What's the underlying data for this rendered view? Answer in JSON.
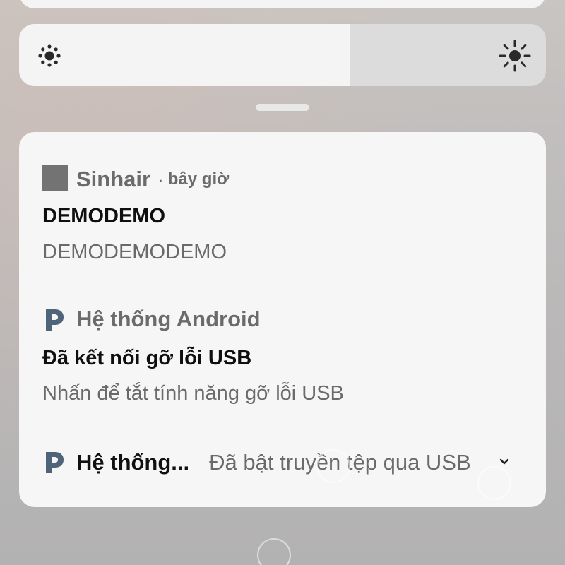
{
  "brightness": {
    "level": 0.627,
    "low_icon": "brightness-low-icon",
    "high_icon": "brightness-high-icon"
  },
  "colors": {
    "card": "#f6f6f6",
    "slider_fill": "#f4f4f4",
    "slider_track": "#dcdcdc",
    "android_icon": "#4f6478"
  },
  "notifications": [
    {
      "app_icon": "app-square-icon",
      "app_name": "Sinhair",
      "separator": "·",
      "time": "bây giờ",
      "title": "DEMODEMO",
      "body": "DEMODEMODEMO"
    },
    {
      "app_icon": "android-system-icon",
      "app_name": "Hệ thống Android",
      "title": "Đã kết nối gỡ lỗi USB",
      "body": "Nhấn để tắt tính năng gỡ lỗi USB"
    },
    {
      "app_icon": "android-system-icon",
      "app_name": "Hệ thống...",
      "summary": "Đã bật truyền tệp qua USB",
      "expand_icon": "chevron-down-icon"
    }
  ]
}
